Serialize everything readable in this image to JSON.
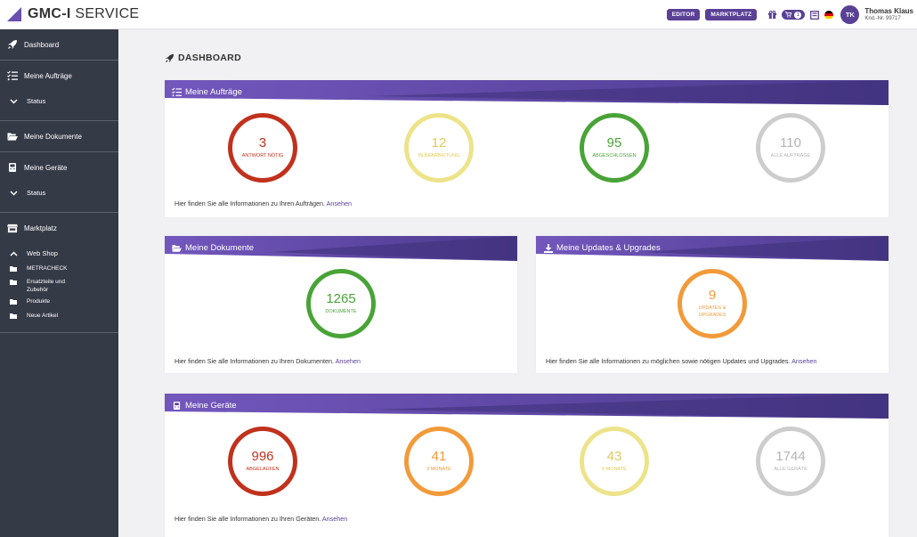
{
  "header": {
    "logo_bold": "GMC-I",
    "logo_light": " SERVICE",
    "editor_label": "EDITOR",
    "marketplace_label": "MARKTPLATZ",
    "cart_count": "1",
    "avatar_initials": "TK",
    "user_name": "Thomas Klaus",
    "customer_no": "Knd.-Nr. 99717"
  },
  "sidebar": {
    "dashboard": "Dashboard",
    "orders": "Meine Aufträge",
    "orders_status": "Status",
    "documents": "Meine Dokumente",
    "devices": "Meine Geräte",
    "devices_status": "Status",
    "marketplace": "Marktplatz",
    "webshop": "Web Shop",
    "leaf_metracheck": "METRACHECK",
    "leaf_parts": "Ersatzteile und Zubehör",
    "leaf_products": "Produkte",
    "leaf_new": "Neue Artikel"
  },
  "main": {
    "title": "DASHBOARD",
    "orders_card": {
      "title": "Meine Aufträge",
      "stats": [
        {
          "value": "3",
          "label": "ANTWORT NÖTIG"
        },
        {
          "value": "12",
          "label": "IN BEARBEITUNG"
        },
        {
          "value": "95",
          "label": "ABGESCHLOSSEN"
        },
        {
          "value": "110",
          "label": "ALLE AUFTRÄGE"
        }
      ],
      "footer": "Hier finden Sie alle Informationen zu Ihren Aufträgen.",
      "link": "Ansehen"
    },
    "documents_card": {
      "title": "Meine Dokumente",
      "stats": [
        {
          "value": "1265",
          "label": "DOKUMENTE"
        }
      ],
      "footer": "Hier finden Sie alle Informationen zu Ihren Dokumenten.",
      "link": "Ansehen"
    },
    "updates_card": {
      "title": "Meine Updates & Upgrades",
      "stats": [
        {
          "value": "9",
          "label": "UPDATES & UPGRADES"
        }
      ],
      "footer": "Hier finden Sie alle Informationen zu möglichen sowie nötigen Updates und Upgrades.",
      "link": "Ansehen"
    },
    "devices_card": {
      "title": "Meine Geräte",
      "stats": [
        {
          "value": "996",
          "label": "ABGELAUFEN"
        },
        {
          "value": "41",
          "label": "3 MONATE"
        },
        {
          "value": "43",
          "label": "6 MONATE"
        },
        {
          "value": "1744",
          "label": "ALLE GERÄTE"
        }
      ],
      "footer": "Hier finden Sie alle Informationen zu Ihren Geräten.",
      "link": "Ansehen"
    }
  },
  "colors": {
    "brand": "#5a4196",
    "header_dark": "#4a3a8c",
    "header_light": "#7357bd",
    "red": "#c0321d",
    "yellow": "#ede38a",
    "yellow_text": "#e2c85a",
    "green": "#49a337",
    "grey": "#cdcdcd",
    "grey_text": "#b5b5b5",
    "orange": "#f29a3a"
  }
}
